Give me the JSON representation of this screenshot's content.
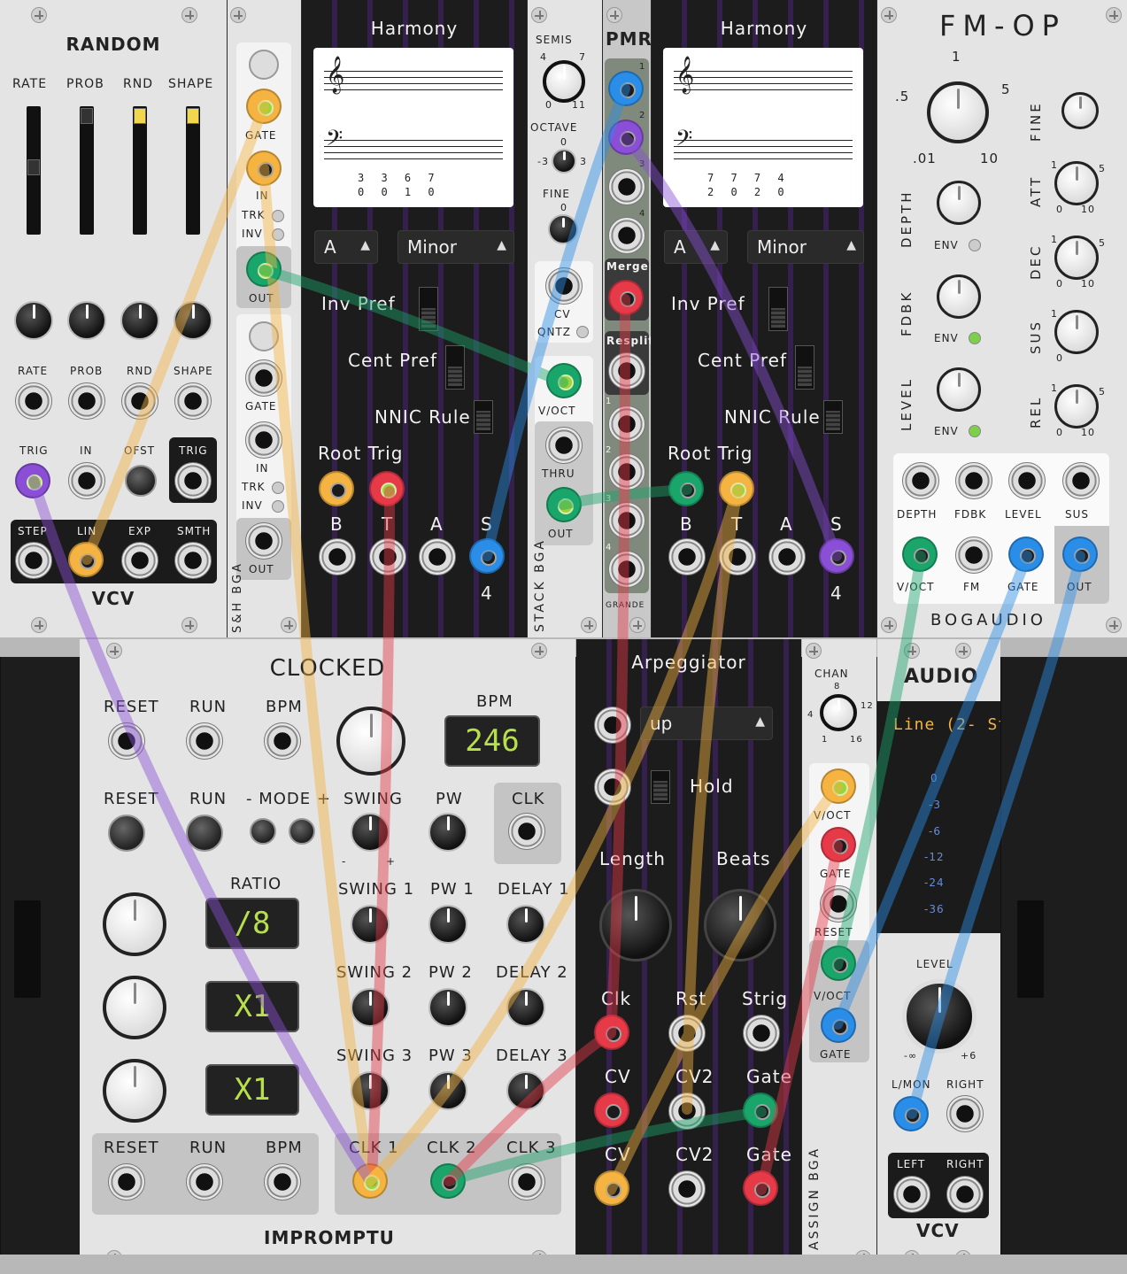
{
  "random": {
    "title": "RANDOM",
    "slider_labels": [
      "RATE",
      "PROB",
      "RND",
      "SHAPE"
    ],
    "knob_labels": [
      "RATE",
      "PROB",
      "RND",
      "SHAPE"
    ],
    "input_labels": [
      "TRIG",
      "IN",
      "OFST",
      "TRIG"
    ],
    "output_labels": [
      "STEP",
      "LIN",
      "EXP",
      "SMTH"
    ],
    "brand": "VCV"
  },
  "sh": {
    "labels": [
      "GATE",
      "IN",
      "TRK",
      "INV",
      "OUT",
      "GATE",
      "IN",
      "TRK",
      "INV",
      "OUT"
    ],
    "vertical": "S&H  BGA"
  },
  "harmony1": {
    "title": "Harmony",
    "score_top": "3 3 6 7",
    "score_bottom": "0 0 1 0",
    "key": "A",
    "mode": "Minor",
    "options": [
      "Inv Pref",
      "Cent Pref",
      "NNIC Rule"
    ],
    "root_trig": "Root Trig",
    "outputs": [
      "B",
      "T",
      "A",
      "S"
    ],
    "voices": "4"
  },
  "stack": {
    "labels": [
      "SEMIS",
      "OCTAVE",
      "FINE",
      "CV",
      "QNTZ",
      "V/OCT",
      "THRU",
      "OUT"
    ],
    "semis_min": "0",
    "semis_max": "11",
    "semis_l": "4",
    "semis_r": "7",
    "oct_min": "-3",
    "oct_max": "3",
    "oct_mid": "0",
    "fine_mid": "0",
    "vertical": "STACK  BGA"
  },
  "pmr": {
    "title": "PMR",
    "merge": "Merge",
    "resplit": "Resplit",
    "nums": [
      "1",
      "2",
      "3",
      "4"
    ],
    "brand": "GRANDE"
  },
  "harmony2": {
    "title": "Harmony",
    "score_top": "7 7 7 4",
    "score_bottom": "2 0 2 0",
    "key": "A",
    "mode": "Minor",
    "options": [
      "Inv Pref",
      "Cent Pref",
      "NNIC Rule"
    ],
    "root_trig": "Root Trig",
    "outputs": [
      "B",
      "T",
      "A",
      "S"
    ],
    "voices": "4"
  },
  "fmop": {
    "title": "FM-OP",
    "ratio_marks": [
      ".5",
      "1",
      "5",
      ".01",
      "10"
    ],
    "left_labels": [
      "DEPTH",
      "FDBK",
      "LEVEL"
    ],
    "right_labels": [
      "FINE",
      "ATT",
      "DEC",
      "SUS",
      "REL"
    ],
    "env": "ENV",
    "zero": "0",
    "one": "1",
    "five": "5",
    "ten": "10",
    "input_labels": [
      "DEPTH",
      "FDBK",
      "LEVEL",
      "SUS"
    ],
    "io_labels": [
      "V/OCT",
      "FM",
      "GATE",
      "OUT"
    ],
    "brand": "BOGAUDIO"
  },
  "clocked": {
    "title": "CLOCKED",
    "row1": [
      "RESET",
      "RUN",
      "BPM"
    ],
    "bpm_label": "BPM",
    "bpm_value": "246",
    "row2": [
      "RESET",
      "RUN",
      "- MODE +",
      "SWING",
      "PW",
      "CLK"
    ],
    "minus": "-",
    "plus": "+",
    "ratio": "RATIO",
    "ratio_values": [
      "/8",
      "X1",
      "X1"
    ],
    "swings": [
      "SWING 1",
      "SWING 2",
      "SWING 3"
    ],
    "pws": [
      "PW 1",
      "PW 2",
      "PW 3"
    ],
    "delays": [
      "DELAY 1",
      "DELAY 2",
      "DELAY 3"
    ],
    "bottom_left": [
      "RESET",
      "RUN",
      "BPM"
    ],
    "bottom_right": [
      "CLK 1",
      "CLK 2",
      "CLK 3"
    ],
    "brand": "IMPROMPTU"
  },
  "arp": {
    "title": "Arpeggiator",
    "mode": "up",
    "hold": "Hold",
    "length": "Length",
    "beats": "Beats",
    "row1": [
      "Clk",
      "Rst",
      "Strig"
    ],
    "row2": [
      "CV",
      "CV2",
      "Gate"
    ],
    "row3": [
      "CV",
      "CV2",
      "Gate"
    ]
  },
  "assign": {
    "chan": "CHAN",
    "chan_marks": [
      "8",
      "4",
      "12",
      "1",
      "16"
    ],
    "labels": [
      "V/OCT",
      "GATE",
      "RESET",
      "V/OCT",
      "GATE"
    ],
    "vertical": "ASSIGN  BGA"
  },
  "audio": {
    "title": "AUDIO",
    "device": "Line (2- St",
    "meter": [
      "0",
      "-3",
      "-6",
      "-12",
      "-24",
      "-36"
    ],
    "level": "LEVEL",
    "level_min": "-∞",
    "level_max": "+6",
    "inputs": [
      "L/MON",
      "RIGHT"
    ],
    "outputs": [
      "LEFT",
      "RIGHT"
    ],
    "brand": "VCV"
  },
  "colors": {
    "cable_orange": "#f5b342",
    "cable_red": "#e63a48",
    "cable_green": "#1aa56b",
    "cable_purple": "#8a4fd6",
    "cable_blue": "#2a8ee8",
    "harmony_purple": "#35204d"
  }
}
